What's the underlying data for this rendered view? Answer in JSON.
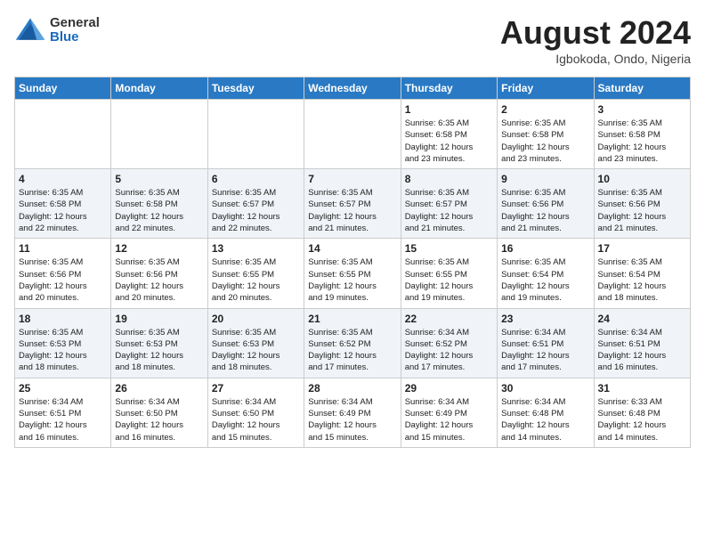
{
  "header": {
    "logo_general": "General",
    "logo_blue": "Blue",
    "month_title": "August 2024",
    "location": "Igbokoda, Ondo, Nigeria"
  },
  "days_of_week": [
    "Sunday",
    "Monday",
    "Tuesday",
    "Wednesday",
    "Thursday",
    "Friday",
    "Saturday"
  ],
  "weeks": [
    [
      {
        "day": "",
        "info": ""
      },
      {
        "day": "",
        "info": ""
      },
      {
        "day": "",
        "info": ""
      },
      {
        "day": "",
        "info": ""
      },
      {
        "day": "1",
        "info": "Sunrise: 6:35 AM\nSunset: 6:58 PM\nDaylight: 12 hours\nand 23 minutes."
      },
      {
        "day": "2",
        "info": "Sunrise: 6:35 AM\nSunset: 6:58 PM\nDaylight: 12 hours\nand 23 minutes."
      },
      {
        "day": "3",
        "info": "Sunrise: 6:35 AM\nSunset: 6:58 PM\nDaylight: 12 hours\nand 23 minutes."
      }
    ],
    [
      {
        "day": "4",
        "info": "Sunrise: 6:35 AM\nSunset: 6:58 PM\nDaylight: 12 hours\nand 22 minutes."
      },
      {
        "day": "5",
        "info": "Sunrise: 6:35 AM\nSunset: 6:58 PM\nDaylight: 12 hours\nand 22 minutes."
      },
      {
        "day": "6",
        "info": "Sunrise: 6:35 AM\nSunset: 6:57 PM\nDaylight: 12 hours\nand 22 minutes."
      },
      {
        "day": "7",
        "info": "Sunrise: 6:35 AM\nSunset: 6:57 PM\nDaylight: 12 hours\nand 21 minutes."
      },
      {
        "day": "8",
        "info": "Sunrise: 6:35 AM\nSunset: 6:57 PM\nDaylight: 12 hours\nand 21 minutes."
      },
      {
        "day": "9",
        "info": "Sunrise: 6:35 AM\nSunset: 6:56 PM\nDaylight: 12 hours\nand 21 minutes."
      },
      {
        "day": "10",
        "info": "Sunrise: 6:35 AM\nSunset: 6:56 PM\nDaylight: 12 hours\nand 21 minutes."
      }
    ],
    [
      {
        "day": "11",
        "info": "Sunrise: 6:35 AM\nSunset: 6:56 PM\nDaylight: 12 hours\nand 20 minutes."
      },
      {
        "day": "12",
        "info": "Sunrise: 6:35 AM\nSunset: 6:56 PM\nDaylight: 12 hours\nand 20 minutes."
      },
      {
        "day": "13",
        "info": "Sunrise: 6:35 AM\nSunset: 6:55 PM\nDaylight: 12 hours\nand 20 minutes."
      },
      {
        "day": "14",
        "info": "Sunrise: 6:35 AM\nSunset: 6:55 PM\nDaylight: 12 hours\nand 19 minutes."
      },
      {
        "day": "15",
        "info": "Sunrise: 6:35 AM\nSunset: 6:55 PM\nDaylight: 12 hours\nand 19 minutes."
      },
      {
        "day": "16",
        "info": "Sunrise: 6:35 AM\nSunset: 6:54 PM\nDaylight: 12 hours\nand 19 minutes."
      },
      {
        "day": "17",
        "info": "Sunrise: 6:35 AM\nSunset: 6:54 PM\nDaylight: 12 hours\nand 18 minutes."
      }
    ],
    [
      {
        "day": "18",
        "info": "Sunrise: 6:35 AM\nSunset: 6:53 PM\nDaylight: 12 hours\nand 18 minutes."
      },
      {
        "day": "19",
        "info": "Sunrise: 6:35 AM\nSunset: 6:53 PM\nDaylight: 12 hours\nand 18 minutes."
      },
      {
        "day": "20",
        "info": "Sunrise: 6:35 AM\nSunset: 6:53 PM\nDaylight: 12 hours\nand 18 minutes."
      },
      {
        "day": "21",
        "info": "Sunrise: 6:35 AM\nSunset: 6:52 PM\nDaylight: 12 hours\nand 17 minutes."
      },
      {
        "day": "22",
        "info": "Sunrise: 6:34 AM\nSunset: 6:52 PM\nDaylight: 12 hours\nand 17 minutes."
      },
      {
        "day": "23",
        "info": "Sunrise: 6:34 AM\nSunset: 6:51 PM\nDaylight: 12 hours\nand 17 minutes."
      },
      {
        "day": "24",
        "info": "Sunrise: 6:34 AM\nSunset: 6:51 PM\nDaylight: 12 hours\nand 16 minutes."
      }
    ],
    [
      {
        "day": "25",
        "info": "Sunrise: 6:34 AM\nSunset: 6:51 PM\nDaylight: 12 hours\nand 16 minutes."
      },
      {
        "day": "26",
        "info": "Sunrise: 6:34 AM\nSunset: 6:50 PM\nDaylight: 12 hours\nand 16 minutes."
      },
      {
        "day": "27",
        "info": "Sunrise: 6:34 AM\nSunset: 6:50 PM\nDaylight: 12 hours\nand 15 minutes."
      },
      {
        "day": "28",
        "info": "Sunrise: 6:34 AM\nSunset: 6:49 PM\nDaylight: 12 hours\nand 15 minutes."
      },
      {
        "day": "29",
        "info": "Sunrise: 6:34 AM\nSunset: 6:49 PM\nDaylight: 12 hours\nand 15 minutes."
      },
      {
        "day": "30",
        "info": "Sunrise: 6:34 AM\nSunset: 6:48 PM\nDaylight: 12 hours\nand 14 minutes."
      },
      {
        "day": "31",
        "info": "Sunrise: 6:33 AM\nSunset: 6:48 PM\nDaylight: 12 hours\nand 14 minutes."
      }
    ]
  ]
}
